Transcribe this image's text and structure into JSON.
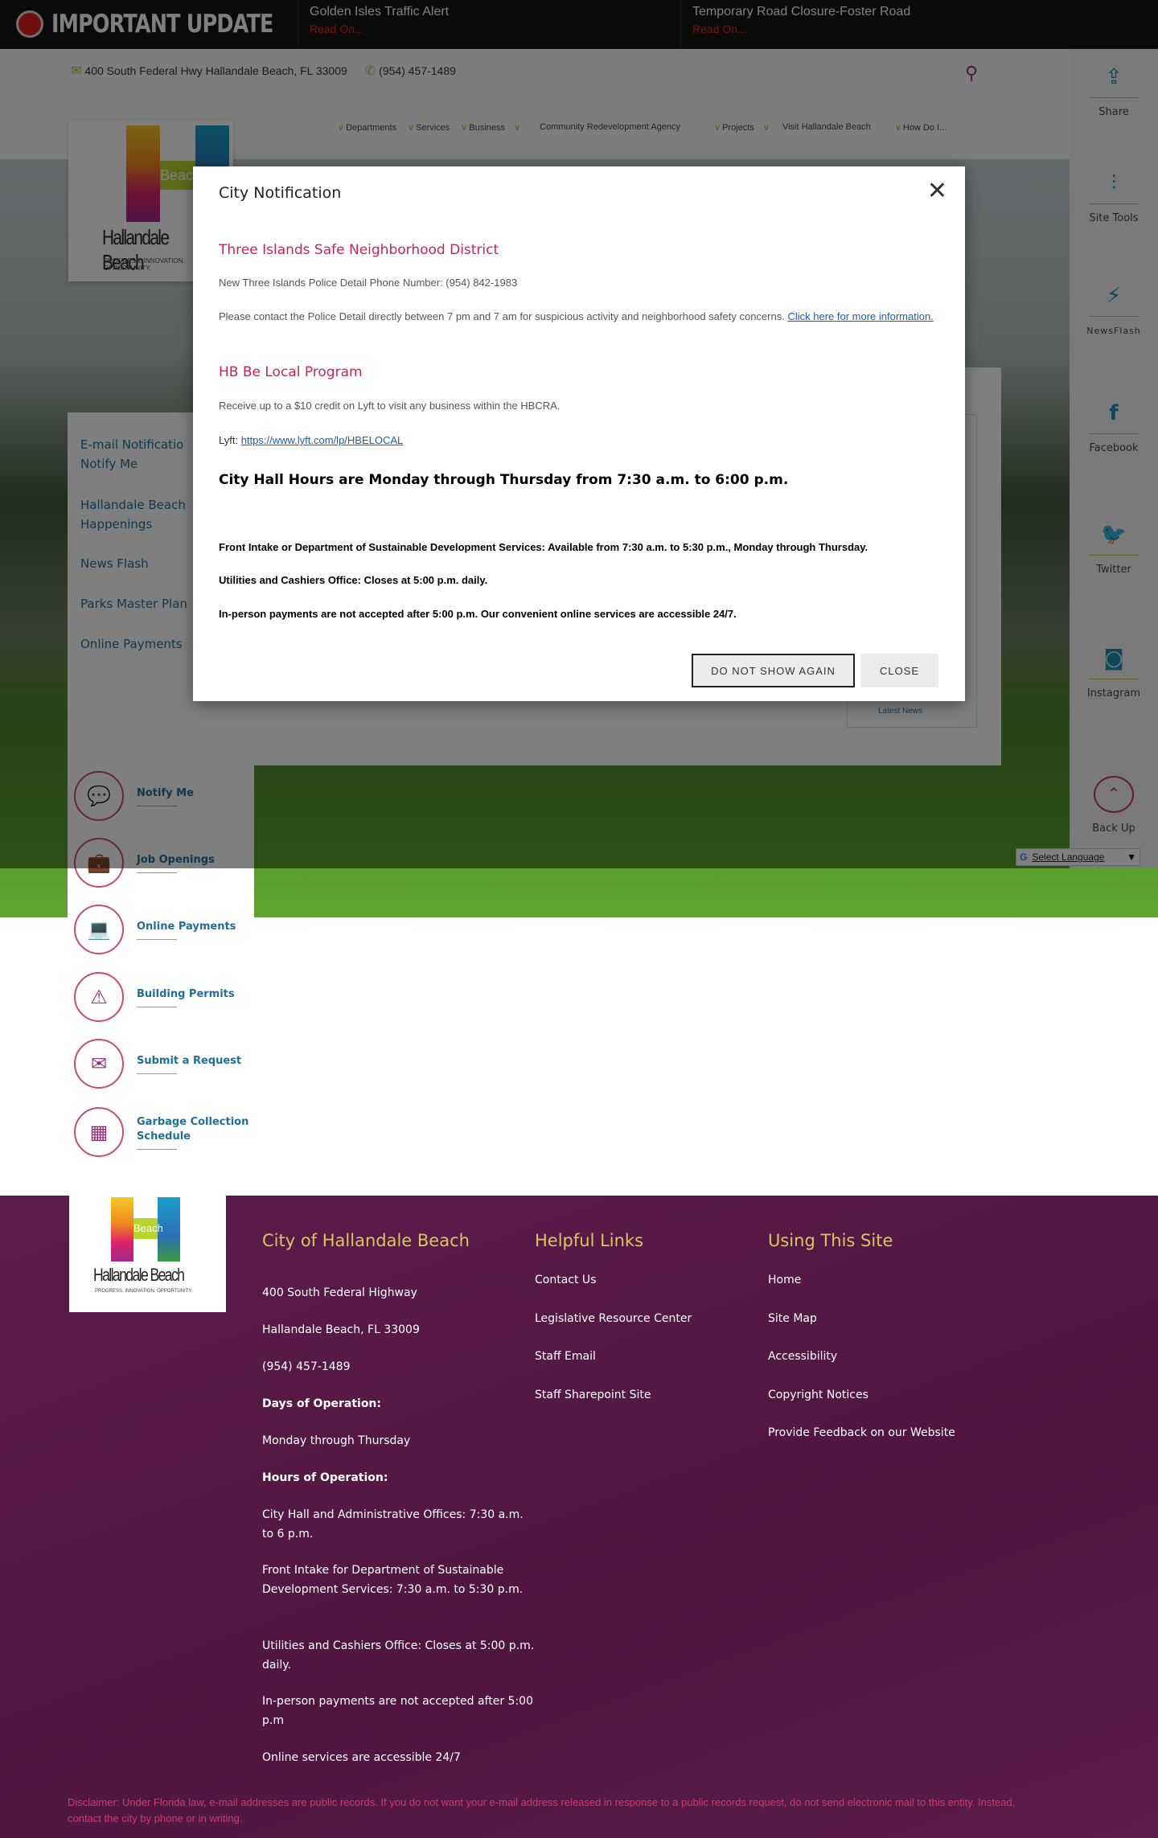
{
  "alert_bar": {
    "label": "IMPORTANT UPDATE",
    "alerts": [
      {
        "title": "Golden Isles Traffic Alert",
        "link": "Read On..."
      },
      {
        "title": "Temporary Road Closure-Foster Road",
        "link": "Read On..."
      }
    ]
  },
  "header": {
    "address": "400 South Federal Hwy Hallandale Beach, FL 33009",
    "phone": "(954) 457-1489",
    "search_icon": "search-icon"
  },
  "nav": [
    "Departments",
    "Services",
    "Business",
    "Community Redevelopment Agency",
    "Projects",
    "Visit Hallandale Beach",
    "How Do I..."
  ],
  "logo": {
    "brand": "Hallandale Beach",
    "word": "Beach",
    "tagline": "PROGRESS. INNOVATION. OPPORTUNITY."
  },
  "left_links": [
    "E-mail Notifications / Notify Me",
    "Hallandale Beach Happenings",
    "News Flash",
    "Parks Master Plan",
    "Online Payments"
  ],
  "left_links_display": [
    "E-mail Notificatio",
    "Notify Me",
    "Hallandale Beach",
    "Happenings",
    "News Flash",
    "Parks Master Plan",
    "Online Payments"
  ],
  "news_box": {
    "link": "Latest News"
  },
  "right_sidebar": [
    {
      "label": "Share",
      "icon": "share-icon"
    },
    {
      "label": "Site Tools",
      "icon": "sliders-icon"
    },
    {
      "label": "NewsFlash",
      "icon": "lightning-icon"
    },
    {
      "label": "Facebook",
      "icon": "facebook-icon"
    },
    {
      "label": "Twitter",
      "icon": "twitter-icon"
    },
    {
      "label": "Instagram",
      "icon": "instagram-icon"
    },
    {
      "label": "Back Up",
      "icon": "chevron-up-icon"
    }
  ],
  "translate": {
    "label": "Select Language"
  },
  "quick_links": [
    {
      "label": "Notify Me",
      "icon": "chat-icon"
    },
    {
      "label": "Job Openings",
      "icon": "briefcase-icon"
    },
    {
      "label": "Online Payments",
      "icon": "laptop-icon"
    },
    {
      "label": "Building Permits",
      "icon": "permit-icon"
    },
    {
      "label": "Submit a Request",
      "icon": "envelope-icon"
    },
    {
      "label": "Garbage Collection Schedule",
      "icon": "calendar-icon"
    }
  ],
  "modal": {
    "title": "City Notification",
    "section1_heading": "Three Islands Safe Neighborhood District",
    "section1_phone": "New Three Islands Police Detail Phone Number: (954) 842-1983",
    "section1_body": "Please contact the Police Detail directly between 7 pm and 7 am for suspicious activity and neighborhood safety concerns. ",
    "section1_link": "Click here for more information. ",
    "section2_heading": "HB Be Local Program",
    "section2_body": "Receive up to a $10 credit on Lyft to visit any business within the HBCRA.",
    "lyft_label": "Lyft: ",
    "lyft_link": "https://www.lyft.com/lp/HBELOCAL",
    "hours_heading": "City Hall Hours are Monday through Thursday from 7:30 a.m. to 6:00 p.m.",
    "line1": "Front Intake or Department of Sustainable Development Services: Available from 7:30 a.m. to 5:30 p.m., Monday through Thursday.",
    "line2": "Utilities and Cashiers Office: Closes at 5:00 p.m. daily.",
    "line3": "In-person payments are not accepted after 5:00 p.m. Our convenient online services are accessible 24/7.",
    "btn_dont_show": "DO NOT SHOW AGAIN",
    "btn_close": "CLOSE"
  },
  "footer": {
    "col1_heading": "City of Hallandale Beach",
    "col1_items": [
      "400 South Federal Highway",
      "Hallandale Beach, FL 33009",
      "(954) 457-1489",
      "Days of Operation:",
      "Monday through Thursday",
      "Hours of Operation:",
      "City Hall and Administrative Offices: 7:30 a.m. to 6 p.m.",
      "Front Intake for Department of Sustainable Development Services: 7:30 a.m. to 5:30 p.m.",
      "Utilities and Cashiers Office: Closes at 5:00 p.m. daily.",
      "In-person payments are not accepted after 5:00 p.m",
      "Online services are accessible 24/7"
    ],
    "col2_heading": "Helpful Links",
    "col2_items": [
      "Contact Us",
      "Legislative Resource Center",
      "Staff Email",
      "Staff Sharepoint Site"
    ],
    "col3_heading": "Using This Site",
    "col3_items": [
      "Home",
      "Site Map",
      "Accessibility",
      "Copyright Notices",
      "Provide Feedback on our Website"
    ],
    "disclaimer": "Disclaimer: Under Florida law, e-mail addresses are public records. If you do not want your e-mail address released in response to a public records request, do not send electronic mail to this entity. Instead, contact the city by phone or in writing."
  },
  "colors": {
    "accent_pink": "#c8245c",
    "link_blue": "#1f6f9a",
    "footer_purple": "#5c1c4c",
    "footer_heading": "#d8c85a"
  }
}
